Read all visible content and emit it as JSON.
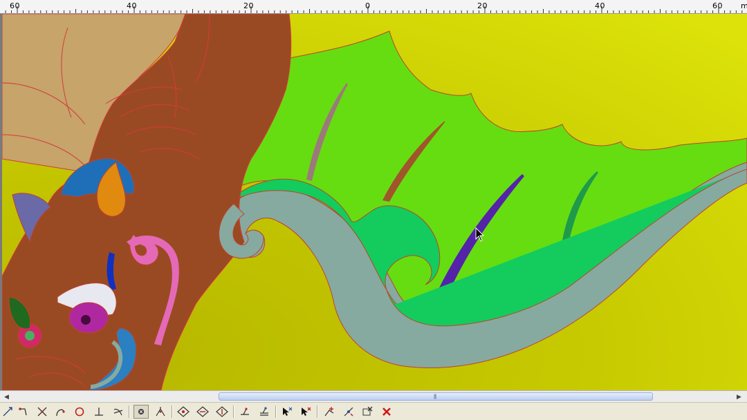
{
  "ruler": {
    "labels": [
      "60",
      "40",
      "20",
      "0",
      "20",
      "40",
      "60",
      "m"
    ]
  },
  "canvas": {
    "description_icon": "drawing-canvas",
    "colors": {
      "background": "#c9c800",
      "wing": "#66dd11",
      "wave": "#13cc5d",
      "wave_outline": "#86aaa0",
      "body": "#9a4a23",
      "outline": "#d43a3a"
    }
  },
  "scrollbar": {
    "left_arrow_icon": "chevron-left-icon",
    "right_arrow_icon": "chevron-right-icon"
  },
  "toolbar": {
    "tools": [
      "snap-node-icon",
      "snap-end-icon",
      "snap-intersection-icon",
      "snap-curve-icon",
      "snap-circle-icon",
      "snap-perpendicular-icon",
      "snap-tangent-icon",
      "snap-center-icon",
      "snap-midpoint-icon",
      "diamond-snap-1-icon",
      "diamond-snap-2-icon",
      "diamond-snap-3-icon",
      "layer-icon",
      "layer-stack-icon",
      "select-node-icon",
      "delete-node-icon",
      "add-point-icon",
      "edit-point-icon",
      "remove-item-icon",
      "close-icon"
    ]
  }
}
